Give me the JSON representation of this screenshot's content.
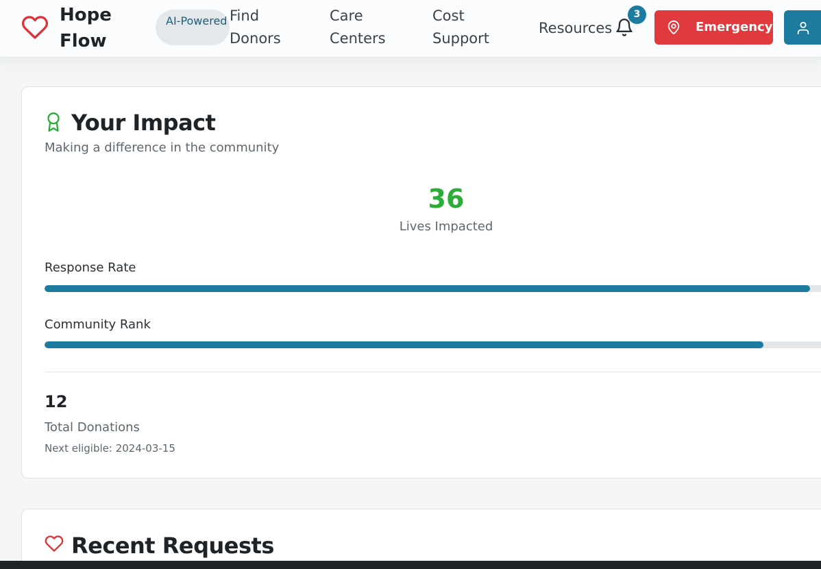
{
  "header": {
    "brand": "Hope Flow",
    "badge": "AI-Powered",
    "nav": [
      {
        "label": "Find Donors"
      },
      {
        "label": "Care Centers"
      },
      {
        "label": "Cost Support"
      },
      {
        "label": "Resources"
      }
    ],
    "notifications_count": "3",
    "emergency_label": "Emergency",
    "icons": {
      "logo": "heart-icon",
      "notifications": "bell-icon",
      "emergency": "map-pin-icon",
      "profile": "user-icon"
    },
    "colors": {
      "brand_red": "#e03a3e",
      "primary_blue": "#1e7ba0"
    }
  },
  "impact": {
    "title": "Your Impact",
    "subtitle": "Making a difference in the community",
    "lives_value": "36",
    "lives_label": "Lives Impacted",
    "metrics": [
      {
        "label": "Response Rate",
        "percent": 98
      },
      {
        "label": "Community Rank",
        "percent": 92
      }
    ],
    "total_donations_value": "12",
    "total_donations_label": "Total Donations",
    "next_eligible": "Next eligible: 2024-03-15",
    "colors": {
      "accent_green": "#2eac3a",
      "bar_fill": "#1e7ba0"
    }
  },
  "requests": {
    "title": "Recent Requests"
  }
}
